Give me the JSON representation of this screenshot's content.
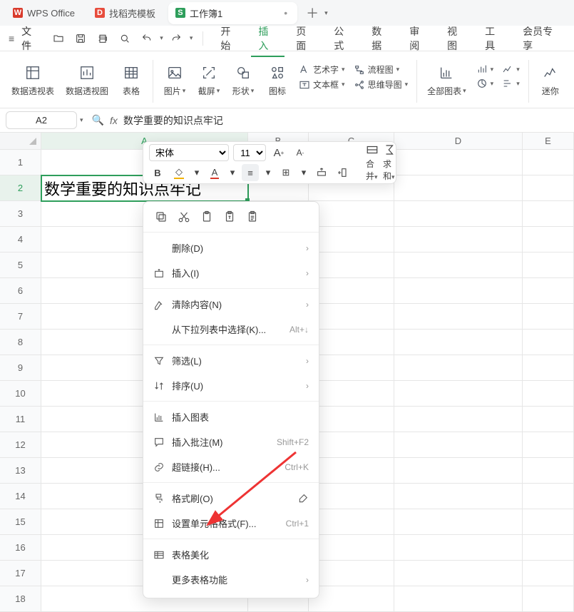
{
  "tabs": {
    "office": "WPS Office",
    "template": "找稻壳模板",
    "workbook": "工作簿1"
  },
  "menu": {
    "file": "文件",
    "items": [
      "开始",
      "插入",
      "页面",
      "公式",
      "数据",
      "审阅",
      "视图",
      "工具",
      "会员专享"
    ],
    "active": "插入"
  },
  "ribbon": {
    "pivottable": "数据透视表",
    "pivotchart": "数据透视图",
    "table": "表格",
    "image": "图片",
    "screenshot": "截屏",
    "shape": "形状",
    "icon": "图标",
    "wordart": "艺术字",
    "flowchart": "流程图",
    "textbox": "文本框",
    "mindmap": "思维导图",
    "allcharts": "全部图表",
    "mini": "迷你"
  },
  "ref": {
    "cell": "A2",
    "fx": "数学重要的知识点牢记"
  },
  "cols": [
    "A",
    "B",
    "C",
    "D",
    "E"
  ],
  "rows": [
    "1",
    "2",
    "3",
    "4",
    "5",
    "6",
    "7",
    "8",
    "9",
    "10",
    "11",
    "12",
    "13",
    "14",
    "15",
    "16",
    "17",
    "18"
  ],
  "cellA2": "数学重要的知识点牢记",
  "minitb": {
    "font": "宋体",
    "size": "11",
    "merge": "合并",
    "sum": "求和"
  },
  "ctx": {
    "delete": "删除(D)",
    "insert": "插入(I)",
    "clear": "清除内容(N)",
    "dropdown": "从下拉列表中选择(K)...",
    "dropdown_sc": "Alt+↓",
    "filter": "筛选(L)",
    "sort": "排序(U)",
    "chart": "插入图表",
    "comment": "插入批注(M)",
    "comment_sc": "Shift+F2",
    "link": "超链接(H)...",
    "link_sc": "Ctrl+K",
    "painter": "格式刷(O)",
    "format": "设置单元格格式(F)...",
    "format_sc": "Ctrl+1",
    "beautify": "表格美化",
    "more": "更多表格功能"
  }
}
